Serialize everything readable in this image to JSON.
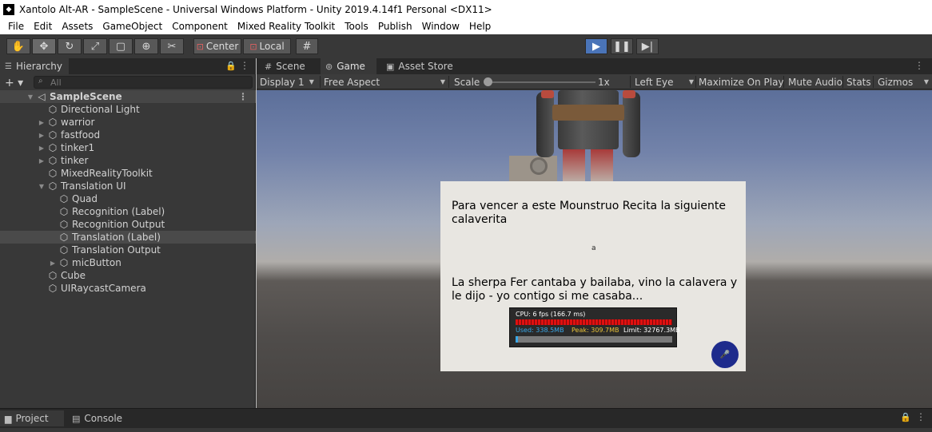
{
  "window": {
    "title": "Xantolo Alt-AR - SampleScene - Universal Windows Platform - Unity 2019.4.14f1 Personal <DX11>"
  },
  "menubar": {
    "items": [
      "File",
      "Edit",
      "Assets",
      "GameObject",
      "Component",
      "Mixed Reality Toolkit",
      "Tools",
      "Publish",
      "Window",
      "Help"
    ]
  },
  "toolbar": {
    "pivot_label": "Center",
    "space_label": "Local",
    "play_active": true
  },
  "hierarchy": {
    "tab_label": "Hierarchy",
    "search_placeholder": "All",
    "scene_name": "SampleScene",
    "items": [
      {
        "label": "Directional Light",
        "expandable": false
      },
      {
        "label": "warrior",
        "expandable": true
      },
      {
        "label": "fastfood",
        "expandable": true
      },
      {
        "label": "tinker1",
        "expandable": true
      },
      {
        "label": "tinker",
        "expandable": true
      },
      {
        "label": "MixedRealityToolkit",
        "expandable": false
      },
      {
        "label": "Translation UI",
        "expandable": true,
        "expanded": true
      },
      {
        "label": "Quad",
        "expandable": false
      },
      {
        "label": "Recognition (Label)",
        "expandable": false
      },
      {
        "label": "Recognition Output",
        "expandable": false
      },
      {
        "label": "Translation (Label)",
        "expandable": false,
        "selected": true
      },
      {
        "label": "Translation Output",
        "expandable": false
      },
      {
        "label": "micButton",
        "expandable": true
      },
      {
        "label": "Cube",
        "expandable": false
      },
      {
        "label": "UIRaycastCamera",
        "expandable": false
      }
    ]
  },
  "game_view": {
    "tabs": {
      "scene": "Scene",
      "game": "Game",
      "asset_store": "Asset Store"
    },
    "controls": {
      "display": "Display 1",
      "aspect": "Free Aspect",
      "scale_label": "Scale",
      "scale_value": "1x",
      "eye": "Left Eye",
      "maximize": "Maximize On Play",
      "mute": "Mute Audio",
      "stats": "Stats",
      "gizmos": "Gizmos"
    },
    "ui_panel": {
      "recognition_label": "Para vencer a este Mounstruo Recita la siguiente calaverita",
      "recognition_output": "a",
      "translation_label": "La sherpa Fer cantaba y bailaba, vino la calavera y le dijo - yo contigo si me casaba...",
      "profiler": {
        "cpu": "CPU: 6 fps (166.7 ms)",
        "used": "Used: 338.5MB",
        "peak": "Peak: 309.7MB",
        "limit": "Limit: 32767.3MB",
        "memory_fraction": 0.01
      }
    }
  },
  "bottom_panel": {
    "project": "Project",
    "console": "Console"
  },
  "colors": {
    "editor_dark": "#383838",
    "play_accent": "#4a74b8",
    "mic_button": "#1e2b8c"
  }
}
